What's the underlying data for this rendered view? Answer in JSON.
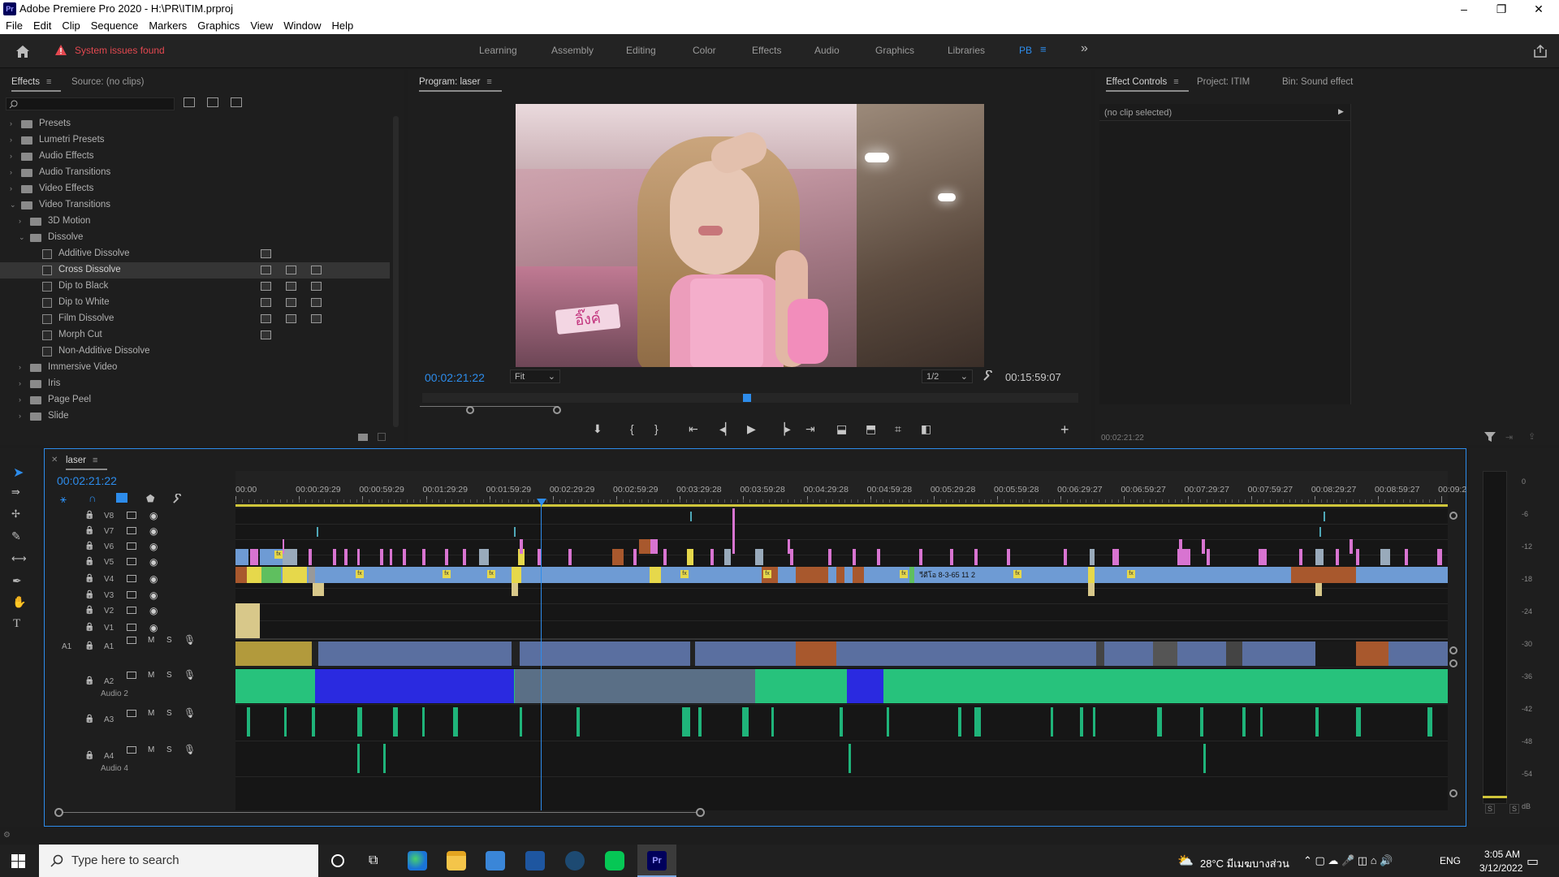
{
  "window": {
    "title": "Adobe Premiere Pro 2020 - H:\\PR\\ITIM.prproj",
    "logo": "Pr",
    "controls": [
      "–",
      "❐",
      "✕"
    ]
  },
  "menu": [
    "File",
    "Edit",
    "Clip",
    "Sequence",
    "Markers",
    "Graphics",
    "View",
    "Window",
    "Help"
  ],
  "workspace": {
    "warning": "System issues found",
    "tabs": [
      "Learning",
      "Assembly",
      "Editing",
      "Color",
      "Effects",
      "Audio",
      "Graphics",
      "Libraries",
      "PB"
    ],
    "active": "PB",
    "more": "»"
  },
  "effects_panel": {
    "tabs": [
      "Effects",
      "Source: (no clips)"
    ],
    "search_placeholder": "",
    "tree": [
      {
        "label": "Presets",
        "level": 0,
        "type": "folder",
        "open": false
      },
      {
        "label": "Lumetri Presets",
        "level": 0,
        "type": "folder",
        "open": false
      },
      {
        "label": "Audio Effects",
        "level": 0,
        "type": "folder",
        "open": false
      },
      {
        "label": "Audio Transitions",
        "level": 0,
        "type": "folder",
        "open": false
      },
      {
        "label": "Video Effects",
        "level": 0,
        "type": "folder",
        "open": false
      },
      {
        "label": "Video Transitions",
        "level": 0,
        "type": "folder",
        "open": true
      },
      {
        "label": "3D Motion",
        "level": 1,
        "type": "folder",
        "open": false
      },
      {
        "label": "Dissolve",
        "level": 1,
        "type": "folder",
        "open": true
      },
      {
        "label": "Additive Dissolve",
        "level": 2,
        "type": "fx",
        "badges": 1
      },
      {
        "label": "Cross Dissolve",
        "level": 2,
        "type": "fx",
        "badges": 3,
        "selected": true
      },
      {
        "label": "Dip to Black",
        "level": 2,
        "type": "fx",
        "badges": 3
      },
      {
        "label": "Dip to White",
        "level": 2,
        "type": "fx",
        "badges": 3
      },
      {
        "label": "Film Dissolve",
        "level": 2,
        "type": "fx",
        "badges": 3
      },
      {
        "label": "Morph Cut",
        "level": 2,
        "type": "fx",
        "badges": 1
      },
      {
        "label": "Non-Additive Dissolve",
        "level": 2,
        "type": "fx",
        "badges": 0
      },
      {
        "label": "Immersive Video",
        "level": 1,
        "type": "folder",
        "open": false
      },
      {
        "label": "Iris",
        "level": 1,
        "type": "folder",
        "open": false
      },
      {
        "label": "Page Peel",
        "level": 1,
        "type": "folder",
        "open": false
      },
      {
        "label": "Slide",
        "level": 1,
        "type": "folder",
        "open": false
      }
    ]
  },
  "program": {
    "tab": "Program: laser",
    "timecode": "00:02:21:22",
    "fit": "Fit",
    "resolution": "1/2",
    "duration": "00:15:59:07",
    "video_sign": "อิ๊งค์"
  },
  "effect_controls": {
    "tabs": [
      "Effect Controls",
      "Project: ITIM",
      "Bin: Sound effect"
    ],
    "no_clip": "(no clip selected)",
    "timecode": "00:02:21:22"
  },
  "timeline": {
    "sequence": "laser",
    "timecode": "00:02:21:22",
    "ruler": [
      "00:00",
      "00:00:29:29",
      "00:00:59:29",
      "00:01:29:29",
      "00:01:59:29",
      "00:02:29:29",
      "00:02:59:29",
      "00:03:29:28",
      "00:03:59:28",
      "00:04:29:28",
      "00:04:59:28",
      "00:05:29:28",
      "00:05:59:28",
      "00:06:29:27",
      "00:06:59:27",
      "00:07:29:27",
      "00:07:59:27",
      "00:08:29:27",
      "00:08:59:27",
      "00:09:2"
    ],
    "video_tracks": [
      "V8",
      "V7",
      "V6",
      "V5",
      "V4",
      "V3",
      "V2",
      "V1"
    ],
    "audio_tracks": [
      {
        "src": "A1",
        "name": "A1",
        "sub": ""
      },
      {
        "src": "",
        "name": "A2",
        "sub": "Audio 2"
      },
      {
        "src": "",
        "name": "A3",
        "sub": ""
      },
      {
        "src": "",
        "name": "A4",
        "sub": "Audio 4"
      }
    ],
    "clip_label": "วีดีโอ 8-3-65 11 2",
    "fx_badge": "fx",
    "m_label": "M",
    "s_label": "S"
  },
  "meter": {
    "ticks": [
      "0",
      "-6",
      "-12",
      "-18",
      "-24",
      "-30",
      "-36",
      "-42",
      "-48",
      "-54",
      "dB"
    ],
    "solo": [
      "S",
      "S"
    ]
  },
  "taskbar": {
    "search_placeholder": "Type here to search",
    "weather": "28°C มีเมฆบางส่วน",
    "lang": "ENG",
    "time": "3:05 AM",
    "date": "3/12/2022"
  },
  "colors": {
    "accent": "#2d8ceb",
    "clip_blue": "#6e9bd4",
    "clip_pink": "#d874d1",
    "clip_yellow": "#e6d84b",
    "clip_orange": "#a8582d",
    "audio_green": "#27c27c",
    "audio_dark_blue": "#2a2ae0",
    "warning_red": "#e34850"
  }
}
